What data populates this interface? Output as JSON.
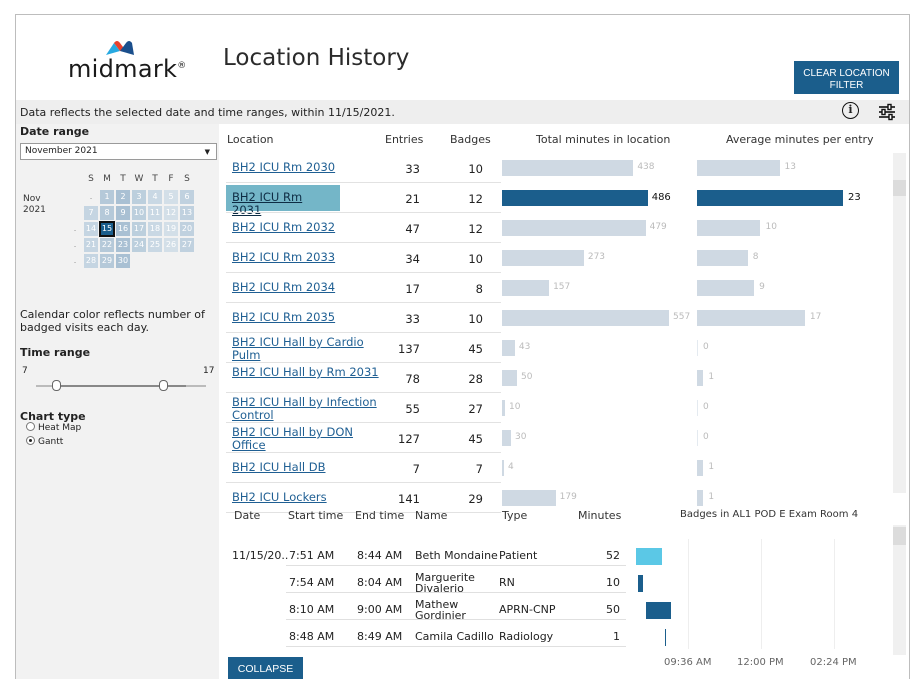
{
  "header": {
    "logo_text": "midmark",
    "title": "Location History",
    "clear_button": "CLEAR LOCATION FILTER"
  },
  "info": {
    "text": "Data reflects the selected date and time ranges, within 11/15/2021.",
    "info_icon": "info-icon",
    "settings_icon": "sliders-icon"
  },
  "sidebar": {
    "date_range_label": "Date range",
    "month_select": "November 2021",
    "calendar": {
      "days_of_week": [
        "S",
        "M",
        "T",
        "W",
        "T",
        "F",
        "S"
      ],
      "month_label": "Nov",
      "year_label": "2021",
      "weeks": [
        [
          ".",
          "1",
          "2",
          "3",
          "4",
          "5",
          "6"
        ],
        [
          "7",
          "8",
          "9",
          "10",
          "11",
          "12",
          "13"
        ],
        [
          ".",
          "14",
          "15",
          "16",
          "17",
          "18",
          "19",
          "20"
        ],
        [
          ".",
          "21",
          "22",
          "23",
          "24",
          "25",
          "26",
          "27"
        ],
        [
          ".",
          "28",
          "29",
          "30"
        ]
      ],
      "selected_day": "15"
    },
    "calendar_note": "Calendar color reflects number of badged visits each day.",
    "time_range_label": "Time range",
    "time_range_min": "7",
    "time_range_max": "17",
    "chart_type_label": "Chart type",
    "chart_types": [
      "Heat Map",
      "Gantt"
    ],
    "chart_type_selected": "Gantt"
  },
  "location_table": {
    "headers": [
      "Location",
      "Entries",
      "Badges",
      "Total minutes in location",
      "Average minutes per entry"
    ],
    "selected_location": "BH2 ICU Rm 2031",
    "colors": {
      "selected": "#1b5e8c",
      "normal": "#cfd9e3",
      "highlight": "#74b6c8"
    },
    "rows": [
      {
        "location": "BH2 ICU Rm 2030",
        "entries": "33",
        "badges": "10",
        "total": "438",
        "avg": "13"
      },
      {
        "location": "BH2 ICU Rm 2031",
        "entries": "21",
        "badges": "12",
        "total": "486",
        "avg": "23"
      },
      {
        "location": "BH2 ICU Rm 2032",
        "entries": "47",
        "badges": "12",
        "total": "479",
        "avg": "10"
      },
      {
        "location": "BH2 ICU Rm 2033",
        "entries": "34",
        "badges": "10",
        "total": "273",
        "avg": "8"
      },
      {
        "location": "BH2 ICU Rm 2034",
        "entries": "17",
        "badges": "8",
        "total": "157",
        "avg": "9"
      },
      {
        "location": "BH2 ICU Rm 2035",
        "entries": "33",
        "badges": "10",
        "total": "557",
        "avg": "17"
      },
      {
        "location": "BH2 ICU Hall by Cardio Pulm",
        "entries": "137",
        "badges": "45",
        "total": "43",
        "avg": "0"
      },
      {
        "location": "BH2 ICU Hall by Rm 2031",
        "entries": "78",
        "badges": "28",
        "total": "50",
        "avg": "1"
      },
      {
        "location": "BH2 ICU Hall by Infection Control",
        "entries": "55",
        "badges": "27",
        "total": "10",
        "avg": "0"
      },
      {
        "location": "BH2 ICU Hall by DON Office",
        "entries": "127",
        "badges": "45",
        "total": "30",
        "avg": "0"
      },
      {
        "location": "BH2 ICU Hall DB",
        "entries": "7",
        "badges": "7",
        "total": "4",
        "avg": "1"
      },
      {
        "location": "BH2 ICU Lockers",
        "entries": "141",
        "badges": "29",
        "total": "179",
        "avg": "1"
      }
    ]
  },
  "detail_table": {
    "headers": [
      "Date",
      "Start time",
      "End time",
      "Name",
      "Type",
      "Minutes"
    ],
    "gantt_title": "Badges in AL1 POD E Exam Room 4",
    "gantt_ticks": [
      "09:36 AM",
      "12:00 PM",
      "02:24 PM"
    ],
    "rows": [
      {
        "date": "11/15/20..",
        "start": "7:51 AM",
        "end": "8:44 AM",
        "name": "Beth Mondaine",
        "type": "Patient",
        "minutes": "52",
        "color": "#5bc8e6"
      },
      {
        "date": "",
        "start": "7:54 AM",
        "end": "8:04 AM",
        "name": "Marguerite Divalerio",
        "type": "RN",
        "minutes": "10",
        "color": "#1b5e8c"
      },
      {
        "date": "",
        "start": "8:10 AM",
        "end": "9:00 AM",
        "name": "Mathew Gordinier",
        "type": "APRN-CNP",
        "minutes": "50",
        "color": "#1b5e8c"
      },
      {
        "date": "",
        "start": "8:48 AM",
        "end": "8:49 AM",
        "name": "Camila Cadillo",
        "type": "Radiology",
        "minutes": "1",
        "color": "#1b5e8c"
      }
    ],
    "collapse_button": "COLLAPSE"
  }
}
